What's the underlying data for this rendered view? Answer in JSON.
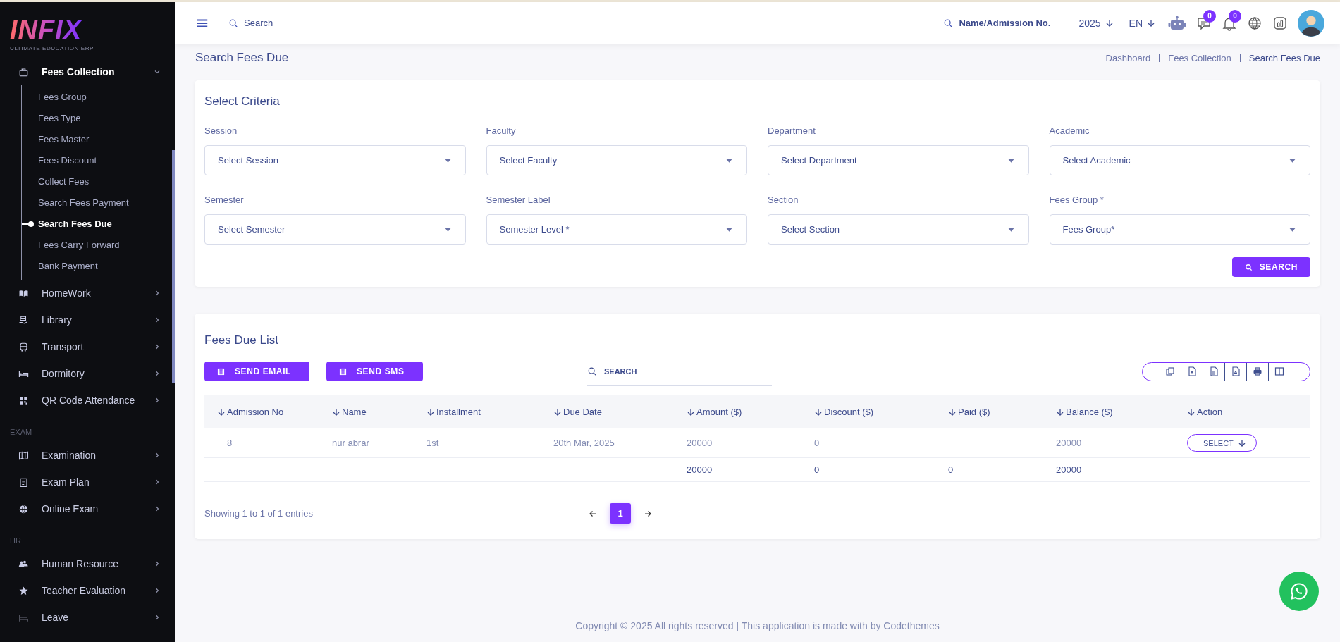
{
  "header": {
    "search": {
      "placeholder": "Search"
    },
    "student_search": {
      "placeholder": "Name/Admission No."
    },
    "year": "2025",
    "language": "EN",
    "messages_badge": "0",
    "notifications_badge": "0"
  },
  "sidebar": {
    "logo": "INFIX",
    "tagline": "ULTIMATE EDUCATION ERP",
    "groups": [
      {
        "items": [
          {
            "label": "Fees Collection",
            "expanded": true,
            "children": [
              {
                "label": "Fees Group",
                "selected": false
              },
              {
                "label": "Fees Type",
                "selected": false
              },
              {
                "label": "Fees Master",
                "selected": false
              },
              {
                "label": "Fees Discount",
                "selected": false
              },
              {
                "label": "Collect Fees",
                "selected": false
              },
              {
                "label": "Search Fees Payment",
                "selected": false
              },
              {
                "label": "Search Fees Due",
                "selected": true
              },
              {
                "label": "Fees Carry Forward",
                "selected": false
              },
              {
                "label": "Bank Payment",
                "selected": false
              }
            ]
          },
          {
            "label": "HomeWork",
            "expanded": false
          },
          {
            "label": "Library",
            "expanded": false
          },
          {
            "label": "Transport",
            "expanded": false
          },
          {
            "label": "Dormitory",
            "expanded": false
          },
          {
            "label": "QR Code Attendance",
            "expanded": false
          }
        ]
      },
      {
        "heading": "EXAM",
        "items": [
          {
            "label": "Examination",
            "expanded": false
          },
          {
            "label": "Exam Plan",
            "expanded": false
          },
          {
            "label": "Online Exam",
            "expanded": false
          }
        ]
      },
      {
        "heading": "HR",
        "items": [
          {
            "label": "Human Resource",
            "expanded": false
          },
          {
            "label": "Teacher Evaluation",
            "expanded": false
          },
          {
            "label": "Leave",
            "expanded": false
          }
        ]
      }
    ]
  },
  "page": {
    "title": "Search Fees Due",
    "breadcrumb": [
      "Dashboard",
      "Fees Collection",
      "Search Fees Due"
    ]
  },
  "criteria": {
    "title": "Select Criteria",
    "fields": [
      {
        "label": "Session",
        "placeholder": "Select Session"
      },
      {
        "label": "Faculty",
        "placeholder": "Select Faculty"
      },
      {
        "label": "Department",
        "placeholder": "Select Department"
      },
      {
        "label": "Academic",
        "placeholder": "Select Academic"
      },
      {
        "label": "Semester",
        "placeholder": "Select Semester"
      },
      {
        "label": "Semester Label",
        "placeholder": "Semester Level *"
      },
      {
        "label": "Section",
        "placeholder": "Select Section"
      },
      {
        "label": "Fees Group *",
        "placeholder": "Fees Group*"
      }
    ],
    "search_button": "SEARCH"
  },
  "due_list": {
    "title": "Fees Due List",
    "actions": [
      "SEND EMAIL",
      "SEND SMS"
    ],
    "search": {
      "placeholder": "SEARCH"
    },
    "columns": [
      "Admission No",
      "Name",
      "Installment",
      "Due Date",
      "Amount ($)",
      "Discount ($)",
      "Paid ($)",
      "Balance ($)",
      "Action"
    ],
    "rows": [
      {
        "cells": [
          "8",
          "nur abrar",
          "1st",
          "20th Mar, 2025",
          "20000",
          "0",
          null,
          "20000"
        ],
        "action": "SELECT"
      }
    ],
    "totals": [
      "20000",
      "0",
      "0",
      "20000"
    ],
    "info": "Showing 1 to 1 of 1 entries",
    "pages": [
      {
        "label": "1",
        "selected": true
      }
    ]
  },
  "footer": "Copyright © 2025 All rights reserved | This application is made with by Codethemes"
}
